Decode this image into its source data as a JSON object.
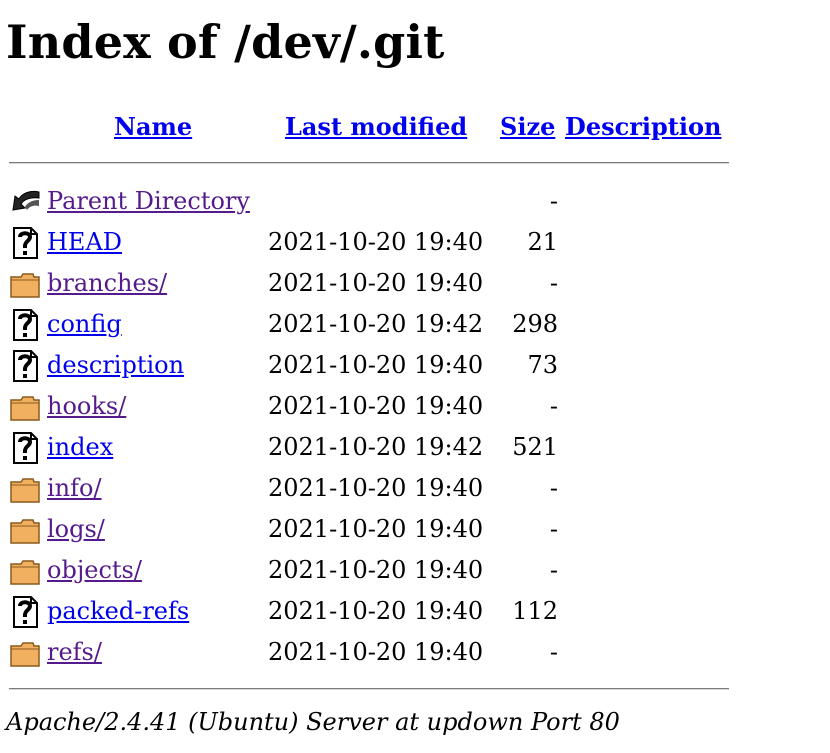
{
  "page": {
    "title": "Index of /dev/.git"
  },
  "columns": {
    "name": "Name",
    "last_modified": "Last modified",
    "size": "Size",
    "description": "Description"
  },
  "entries": [
    {
      "icon": "back-icon",
      "name": "Parent Directory",
      "modified": "",
      "size": "-",
      "visited": true
    },
    {
      "icon": "unknown-file-icon",
      "name": "HEAD",
      "modified": "2021-10-20 19:40",
      "size": "21",
      "visited": false
    },
    {
      "icon": "folder-icon",
      "name": "branches/",
      "modified": "2021-10-20 19:40",
      "size": "-",
      "visited": true
    },
    {
      "icon": "unknown-file-icon",
      "name": "config",
      "modified": "2021-10-20 19:42",
      "size": "298",
      "visited": false
    },
    {
      "icon": "unknown-file-icon",
      "name": "description",
      "modified": "2021-10-20 19:40",
      "size": "73",
      "visited": false
    },
    {
      "icon": "folder-icon",
      "name": "hooks/",
      "modified": "2021-10-20 19:40",
      "size": "-",
      "visited": true
    },
    {
      "icon": "unknown-file-icon",
      "name": "index",
      "modified": "2021-10-20 19:42",
      "size": "521",
      "visited": false
    },
    {
      "icon": "folder-icon",
      "name": "info/",
      "modified": "2021-10-20 19:40",
      "size": "-",
      "visited": true
    },
    {
      "icon": "folder-icon",
      "name": "logs/",
      "modified": "2021-10-20 19:40",
      "size": "-",
      "visited": true
    },
    {
      "icon": "folder-icon",
      "name": "objects/",
      "modified": "2021-10-20 19:40",
      "size": "-",
      "visited": true
    },
    {
      "icon": "unknown-file-icon",
      "name": "packed-refs",
      "modified": "2021-10-20 19:40",
      "size": "112",
      "visited": false
    },
    {
      "icon": "folder-icon",
      "name": "refs/",
      "modified": "2021-10-20 19:40",
      "size": "-",
      "visited": true
    }
  ],
  "footer": {
    "server_signature": "Apache/2.4.41 (Ubuntu) Server at updown Port 80"
  },
  "colors": {
    "link": "#0000ee",
    "visited_link": "#551a8b",
    "folder_fill": "#f0b060",
    "folder_stroke": "#8a5a1c"
  }
}
